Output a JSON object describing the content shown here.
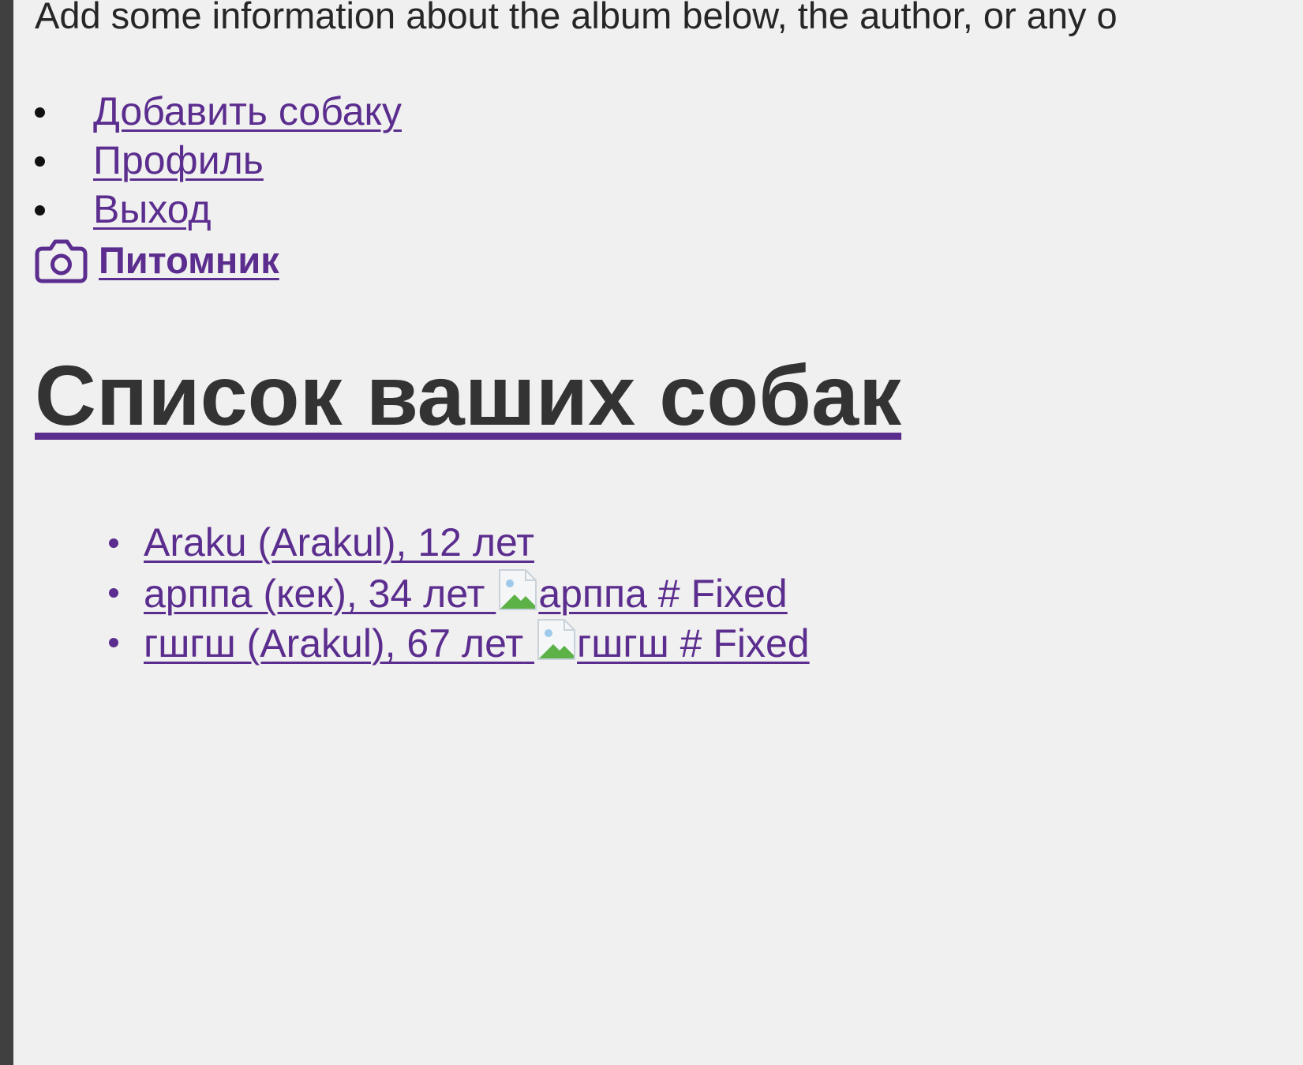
{
  "intro": {
    "text": "Add some information about the album below, the author, or any o"
  },
  "nav": {
    "items": [
      {
        "label": "Добавить собаку"
      },
      {
        "label": "Профиль"
      },
      {
        "label": "Выход"
      }
    ]
  },
  "brand": {
    "icon": "camera-icon",
    "label": "Питомник"
  },
  "page": {
    "title": "Список ваших собак"
  },
  "dogs": {
    "items": [
      {
        "text": "Araku (Arakul), 12 лет",
        "image_alt": ""
      },
      {
        "text": "арппа (кек), 34 лет",
        "image_alt": "арппа # Fixed"
      },
      {
        "text": "гшгш (Arakul), 67 лет",
        "image_alt": "гшгш # Fixed"
      }
    ]
  },
  "colors": {
    "link": "#5b2d8e",
    "background": "#f0f0f0",
    "left_rail": "#404040",
    "heading": "#333333"
  }
}
